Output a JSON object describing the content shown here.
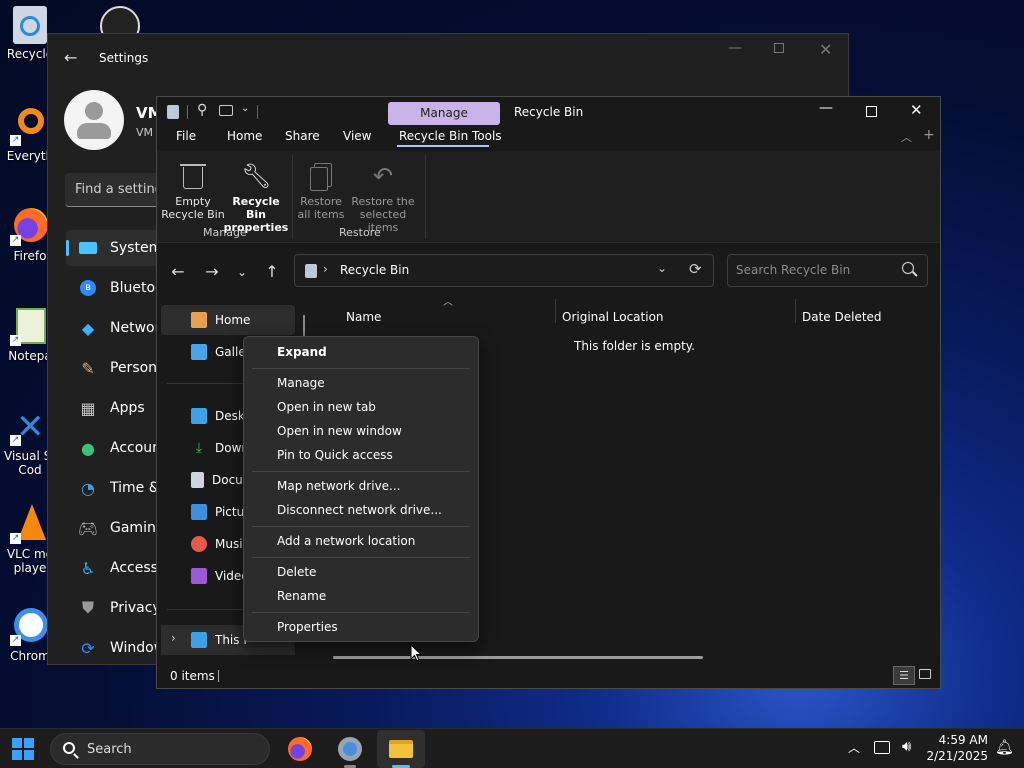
{
  "desktop": {
    "icons": [
      {
        "label": "Recycle",
        "icon": "recycle-bin-icon"
      },
      {
        "label": "Everyth",
        "icon": "everything-search-icon"
      },
      {
        "label": "Firefo",
        "icon": "firefox-icon"
      },
      {
        "label": "Notepa",
        "icon": "notepad-icon"
      },
      {
        "label": "Visual St\nCod",
        "icon": "vscode-icon"
      },
      {
        "label": "VLC me\nplaye",
        "icon": "vlc-icon"
      },
      {
        "label": "Chrom",
        "icon": "chrome-icon"
      }
    ]
  },
  "settings": {
    "title": "Settings",
    "user_name": "VM",
    "user_sub": "VM",
    "search_placeholder": "Find a setting",
    "nav": [
      {
        "label": "System",
        "icon": "system-icon",
        "color": "#4cc2ff"
      },
      {
        "label": "Bluetoo",
        "icon": "bluetooth-icon",
        "color": "#2f8cff"
      },
      {
        "label": "Network",
        "icon": "network-icon",
        "color": "#3bb0ff"
      },
      {
        "label": "Persona",
        "icon": "personalization-icon",
        "color": "#e8a25a"
      },
      {
        "label": "Apps",
        "icon": "apps-icon",
        "color": "#c4c4c4"
      },
      {
        "label": "Account",
        "icon": "accounts-icon",
        "color": "#39c27a"
      },
      {
        "label": "Time &",
        "icon": "time-language-icon",
        "color": "#3d9ee8"
      },
      {
        "label": "Gaming",
        "icon": "gaming-icon",
        "color": "#b8b8b8"
      },
      {
        "label": "Accessi",
        "icon": "accessibility-icon",
        "color": "#42a7f0"
      },
      {
        "label": "Privacy",
        "icon": "privacy-icon",
        "color": "#9a9a9a"
      },
      {
        "label": "Window",
        "icon": "windows-update-icon",
        "color": "#2f8cff"
      }
    ]
  },
  "explorer": {
    "title": "Recycle Bin",
    "manage_tab": "Manage",
    "tabs": [
      "File",
      "Home",
      "Share",
      "View",
      "Recycle Bin Tools"
    ],
    "ribbon": {
      "empty": "Empty\nRecycle Bin",
      "properties": "Recycle Bin\nproperties",
      "restore_all": "Restore\nall items",
      "restore_selected": "Restore the\nselected items",
      "group_manage": "Manage",
      "group_restore": "Restore"
    },
    "address": "Recycle Bin",
    "search_placeholder": "Search Recycle Bin",
    "sidebar": [
      {
        "label": "Home",
        "icon": "home-icon",
        "color": "#e9a04f"
      },
      {
        "label": "Galler",
        "icon": "gallery-icon",
        "color": "#4aa3ea"
      },
      {
        "label": "Deskto",
        "icon": "desktop-folder-icon",
        "color": "#3da1e8"
      },
      {
        "label": "Down",
        "icon": "downloads-icon",
        "color": "#39b872"
      },
      {
        "label": "Docur",
        "icon": "documents-icon",
        "color": "#cfd5df"
      },
      {
        "label": "Pictur",
        "icon": "pictures-icon",
        "color": "#3e8fe0"
      },
      {
        "label": "Music",
        "icon": "music-icon",
        "color": "#e55a4a"
      },
      {
        "label": "Video",
        "icon": "videos-icon",
        "color": "#9a5ad8"
      },
      {
        "label": "This P",
        "icon": "this-pc-icon",
        "color": "#3da1e8"
      }
    ],
    "columns": [
      "Name",
      "Original Location",
      "Date Deleted"
    ],
    "empty_message": "This folder is empty.",
    "status": "0 items"
  },
  "context_menu": {
    "items": [
      "Expand",
      "Manage",
      "Open in new tab",
      "Open in new window",
      "Pin to Quick access",
      "Map network drive...",
      "Disconnect network drive...",
      "Add a network location",
      "Delete",
      "Rename",
      "Properties"
    ]
  },
  "taskbar": {
    "search": "Search",
    "time": "4:59 AM",
    "date": "2/21/2025"
  }
}
